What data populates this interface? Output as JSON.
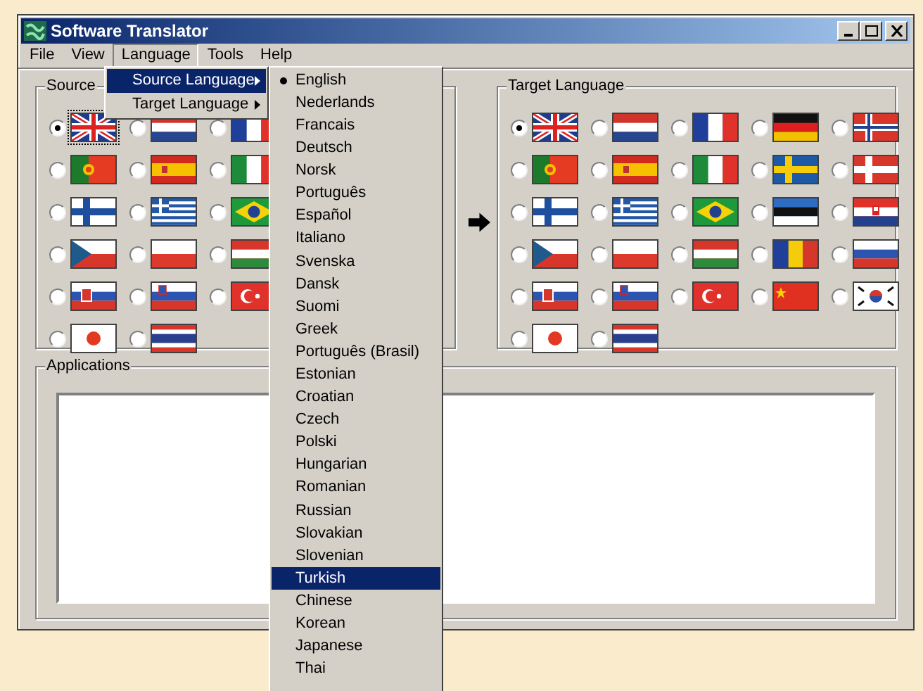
{
  "window": {
    "title": "Software Translator"
  },
  "menu_bar": [
    {
      "label": "File",
      "selected": false
    },
    {
      "label": "View",
      "selected": false
    },
    {
      "label": "Language",
      "selected": true
    },
    {
      "label": "Tools",
      "selected": false
    },
    {
      "label": "Help",
      "selected": false
    }
  ],
  "language_menu": [
    {
      "label": "Source Language",
      "selected": true
    },
    {
      "label": "Target Language",
      "selected": false
    }
  ],
  "source_language_menu": [
    {
      "label": "English",
      "checked": true,
      "selected": false
    },
    {
      "label": "Nederlands",
      "checked": false,
      "selected": false
    },
    {
      "label": "Francais",
      "checked": false,
      "selected": false
    },
    {
      "label": "Deutsch",
      "checked": false,
      "selected": false
    },
    {
      "label": "Norsk",
      "checked": false,
      "selected": false
    },
    {
      "label": "Português",
      "checked": false,
      "selected": false
    },
    {
      "label": "Español",
      "checked": false,
      "selected": false
    },
    {
      "label": "Italiano",
      "checked": false,
      "selected": false
    },
    {
      "label": "Svenska",
      "checked": false,
      "selected": false
    },
    {
      "label": "Dansk",
      "checked": false,
      "selected": false
    },
    {
      "label": "Suomi",
      "checked": false,
      "selected": false
    },
    {
      "label": "Greek",
      "checked": false,
      "selected": false
    },
    {
      "label": "Português (Brasil)",
      "checked": false,
      "selected": false
    },
    {
      "label": "Estonian",
      "checked": false,
      "selected": false
    },
    {
      "label": "Croatian",
      "checked": false,
      "selected": false
    },
    {
      "label": "Czech",
      "checked": false,
      "selected": false
    },
    {
      "label": "Polski",
      "checked": false,
      "selected": false
    },
    {
      "label": "Hungarian",
      "checked": false,
      "selected": false
    },
    {
      "label": "Romanian",
      "checked": false,
      "selected": false
    },
    {
      "label": "Russian",
      "checked": false,
      "selected": false
    },
    {
      "label": "Slovakian",
      "checked": false,
      "selected": false
    },
    {
      "label": "Slovenian",
      "checked": false,
      "selected": false
    },
    {
      "label": "Turkish",
      "checked": false,
      "selected": true
    },
    {
      "label": "Chinese",
      "checked": false,
      "selected": false
    },
    {
      "label": "Korean",
      "checked": false,
      "selected": false
    },
    {
      "label": "Japanese",
      "checked": false,
      "selected": false
    },
    {
      "label": "Thai",
      "checked": false,
      "selected": false
    }
  ],
  "source_group": {
    "title": "Source",
    "flags": [
      {
        "kind": "gb",
        "selected": true
      },
      {
        "kind": "nl",
        "selected": false
      },
      {
        "kind": "fr",
        "selected": false
      },
      {
        "kind": "pt",
        "selected": false
      },
      {
        "kind": "es",
        "selected": false
      },
      {
        "kind": "it",
        "selected": false
      },
      {
        "kind": "fi",
        "selected": false
      },
      {
        "kind": "gr",
        "selected": false
      },
      {
        "kind": "br",
        "selected": false
      },
      {
        "kind": "cz",
        "selected": false
      },
      {
        "kind": "pl",
        "selected": false
      },
      {
        "kind": "hu",
        "selected": false
      },
      {
        "kind": "sk",
        "selected": false
      },
      {
        "kind": "si",
        "selected": false
      },
      {
        "kind": "tr",
        "selected": false
      },
      {
        "kind": "jp",
        "selected": false
      },
      {
        "kind": "th",
        "selected": false
      }
    ]
  },
  "target_group": {
    "title": "Target Language",
    "flags": [
      {
        "kind": "gb",
        "selected": true
      },
      {
        "kind": "nl",
        "selected": false
      },
      {
        "kind": "fr",
        "selected": false
      },
      {
        "kind": "de",
        "selected": false
      },
      {
        "kind": "no",
        "selected": false
      },
      {
        "kind": "pt",
        "selected": false
      },
      {
        "kind": "es",
        "selected": false
      },
      {
        "kind": "it",
        "selected": false
      },
      {
        "kind": "se",
        "selected": false
      },
      {
        "kind": "dk",
        "selected": false
      },
      {
        "kind": "fi",
        "selected": false
      },
      {
        "kind": "gr",
        "selected": false
      },
      {
        "kind": "br",
        "selected": false
      },
      {
        "kind": "ee",
        "selected": false
      },
      {
        "kind": "hr",
        "selected": false
      },
      {
        "kind": "cz",
        "selected": false
      },
      {
        "kind": "pl",
        "selected": false
      },
      {
        "kind": "hu",
        "selected": false
      },
      {
        "kind": "ro",
        "selected": false
      },
      {
        "kind": "ru",
        "selected": false
      },
      {
        "kind": "sk",
        "selected": false
      },
      {
        "kind": "si",
        "selected": false
      },
      {
        "kind": "tr",
        "selected": false
      },
      {
        "kind": "cn",
        "selected": false
      },
      {
        "kind": "kr",
        "selected": false
      },
      {
        "kind": "jp",
        "selected": false
      },
      {
        "kind": "th",
        "selected": false
      }
    ]
  },
  "applications": {
    "title": "Applications"
  }
}
